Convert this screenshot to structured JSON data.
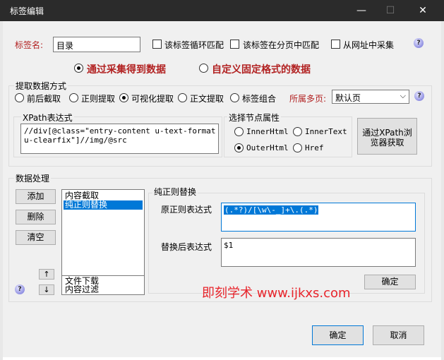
{
  "window": {
    "title": "标签编辑",
    "min": "—",
    "max": "☐",
    "close": "✕"
  },
  "tag": {
    "label": "标签名:",
    "value": "目录"
  },
  "options": {
    "loop_match": "该标签循环匹配",
    "in_page_match": "该标签在分页中匹配",
    "from_url": "从网址中采集"
  },
  "source": {
    "collect": "通过采集得到数据",
    "fixed": "自定义固定格式的数据"
  },
  "extract": {
    "group_title": "提取数据方式",
    "modes": [
      "前后截取",
      "正则提取",
      "可视化提取",
      "正文提取",
      "标签组合"
    ],
    "page_label": "所属多页:",
    "page_value": "默认页"
  },
  "xpath": {
    "group_title": "XPath表达式",
    "value": "//div[@class=\"entry-content u-text-format u-clearfix\"]//img/@src"
  },
  "node": {
    "group_title": "选择节点属性",
    "inner_html": "InnerHtml",
    "inner_text": "InnerText",
    "outer_html": "OuterHtml",
    "href": "Href",
    "get_button": "通过XPath浏览器获取"
  },
  "processing": {
    "group_title": "数据处理",
    "add": "添加",
    "delete": "删除",
    "clear": "清空",
    "up": "↑",
    "down": "↓",
    "list_top": [
      "内容截取",
      "纯正则替换"
    ],
    "list_bottom": [
      "文件下载",
      "内容过滤"
    ]
  },
  "regex": {
    "group_title": "纯正则替换",
    "original_label": "原正则表达式",
    "original_value": "(.*?)/[\\w\\-_]+\\.(.*)",
    "replace_label": "替换后表达式",
    "replace_value": "$1",
    "confirm": "确定"
  },
  "watermark": "即刻学术 www.ijkxs.com",
  "footer": {
    "ok": "确定",
    "cancel": "取消"
  },
  "colors": {
    "accent": "#0078d7",
    "label_red": "#b22222",
    "watermark": "#e8242b"
  },
  "icons": {
    "help": "help-icon"
  }
}
